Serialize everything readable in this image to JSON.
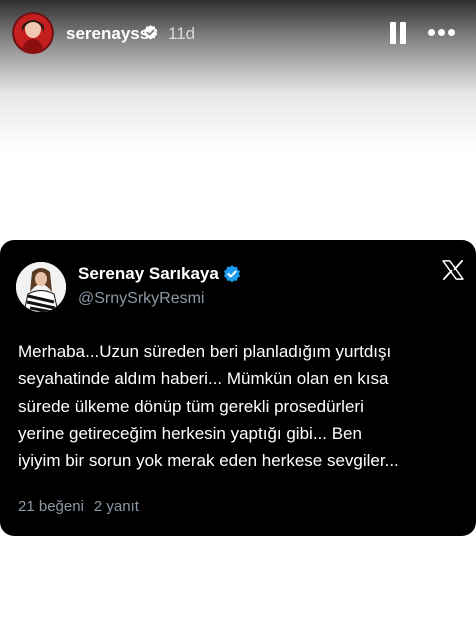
{
  "story": {
    "username": "serenayss",
    "time_ago": "11d",
    "icons": {
      "verified": "verified-badge-icon",
      "pause": "pause-icon",
      "more": "more-options-icon"
    }
  },
  "tweet": {
    "display_name": "Serenay Sarıkaya",
    "handle": "@SrnySrkyResmi",
    "text_lines": [
      "Merhaba...Uzun süreden beri planladığım yurtdışı",
      "seyahatinde aldım haberi... Mümkün olan en kısa",
      "sürede ülkeme dönüp tüm gerekli prosedürleri",
      "yerine getireceğim herkesin yaptığı gibi... Ben",
      "iyiyim bir sorun yok merak eden herkese sevgiler..."
    ],
    "likes": "21 beğeni",
    "replies": "2 yanıt",
    "verified_color": "#1d9bf0",
    "icons": {
      "verified": "verified-badge-icon",
      "platform": "x-logo-icon"
    }
  }
}
